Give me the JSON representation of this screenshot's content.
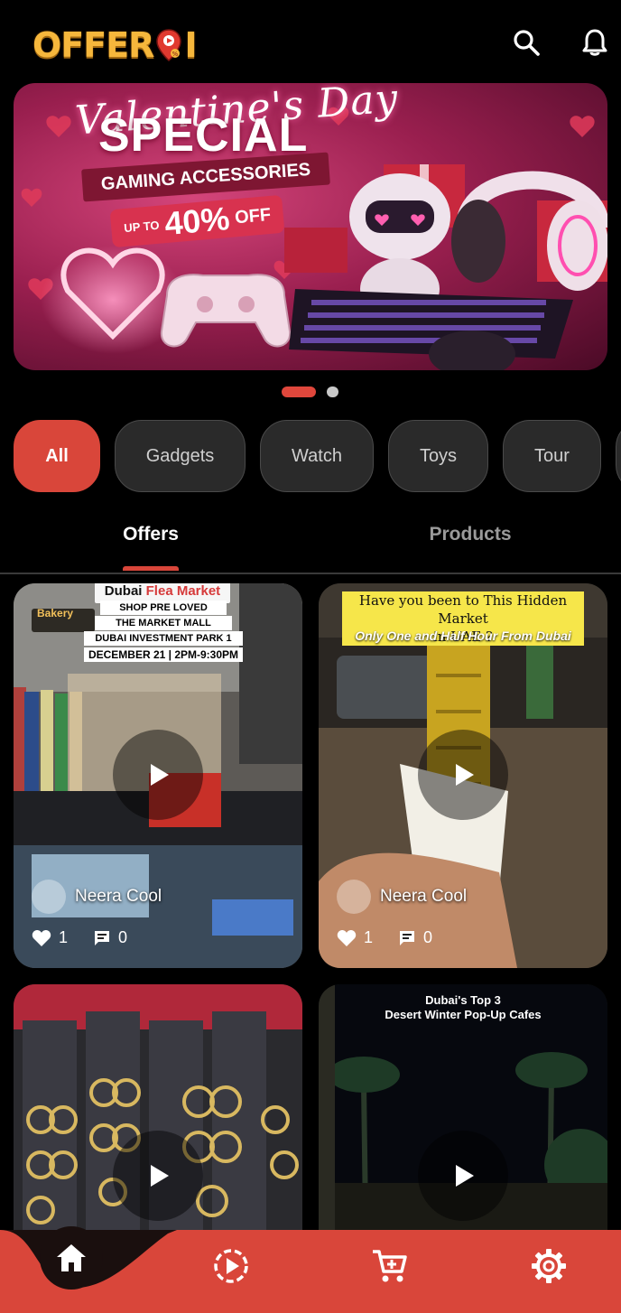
{
  "header": {
    "logo_text_left": "OFFER",
    "logo_text_right": "I",
    "icons": [
      "search-icon",
      "bell-icon"
    ]
  },
  "banner": {
    "title_line1": "Valentine's Day",
    "title_line2": "SPECIAL",
    "subtitle": "GAMING ACCESSORIES",
    "promo_prefix": "UP TO",
    "promo_value": "40%",
    "promo_suffix": "OFF",
    "slide_index": 1,
    "slide_count": 2
  },
  "categories": [
    {
      "label": "All",
      "active": true
    },
    {
      "label": "Gadgets",
      "active": false
    },
    {
      "label": "Watch",
      "active": false
    },
    {
      "label": "Toys",
      "active": false
    },
    {
      "label": "Tour",
      "active": false
    }
  ],
  "tabs": {
    "offers": "Offers",
    "products": "Products",
    "active": "Offers"
  },
  "cards": [
    {
      "author": "Neera Cool",
      "likes": "1",
      "comments": "0",
      "overlay": {
        "line1a": "Dubai ",
        "line1b": "Flea Market",
        "line2": "SHOP PRE LOVED",
        "line3": "THE MARKET MALL",
        "line4": "DUBAI INVESTMENT PARK 1",
        "line5": "DECEMBER 21 | 2PM-9:30PM",
        "shop_sign": "Bakery"
      }
    },
    {
      "author": "Neera Cool",
      "likes": "1",
      "comments": "0",
      "overlay": {
        "line1": "Have you been to This Hidden Market",
        "line2": "in UAE ?",
        "line3": "Only One and Half Hour From Dubai"
      }
    },
    {
      "author": "",
      "likes": "",
      "comments": "",
      "overlay": {}
    },
    {
      "author": "",
      "likes": "",
      "comments": "",
      "overlay": {
        "line1": "Dubai's Top 3",
        "line2": "Desert Winter Pop-Up Cafes"
      }
    }
  ],
  "bottom_nav": {
    "items": [
      "home-icon",
      "play-icon",
      "cart-icon",
      "settings-icon"
    ],
    "active": "home-icon"
  },
  "colors": {
    "accent": "#d9463a",
    "background": "#000000",
    "chip": "#2a2a2a",
    "logo": "#f6b73c"
  }
}
